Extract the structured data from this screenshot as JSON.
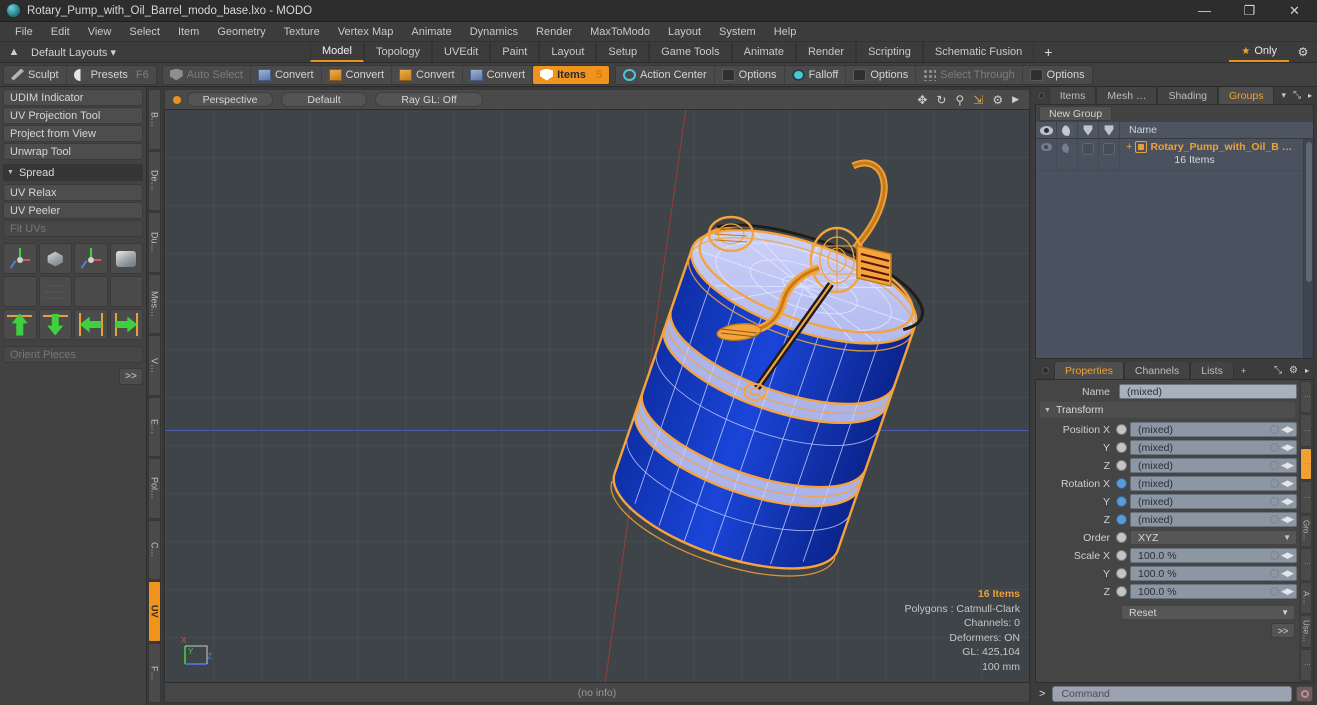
{
  "titlebar": {
    "title": "Rotary_Pump_with_Oil_Barrel_modo_base.lxo - MODO",
    "minimize": "—",
    "maximize": "❐",
    "close": "✕"
  },
  "menubar": {
    "items": [
      "File",
      "Edit",
      "View",
      "Select",
      "Item",
      "Geometry",
      "Texture",
      "Vertex Map",
      "Animate",
      "Dynamics",
      "Render",
      "MaxToModo",
      "Layout",
      "System",
      "Help"
    ]
  },
  "layoutbar": {
    "default_layouts": "Default Layouts ▾",
    "tabs": [
      "Model",
      "Topology",
      "UVEdit",
      "Paint",
      "Layout",
      "Setup",
      "Game Tools",
      "Animate",
      "Render",
      "Scripting",
      "Schematic Fusion"
    ],
    "active_tab": "Model",
    "plus": "+",
    "only_label": "Only",
    "gear": "⚙"
  },
  "modebar": {
    "group1": [
      {
        "label": "Sculpt",
        "icon": "sculpt-icon",
        "state": "normal"
      },
      {
        "label": "Presets",
        "icon": "presets-icon",
        "state": "normal",
        "shortcut": "F6"
      }
    ],
    "group2": [
      {
        "label": "Auto Select",
        "icon": "shield-icon",
        "state": "dim"
      },
      {
        "label": "Convert",
        "icon": "vertex-icon",
        "state": "normal"
      },
      {
        "label": "Convert",
        "icon": "edge-icon",
        "state": "normal"
      },
      {
        "label": "Convert",
        "icon": "polygon-icon",
        "state": "normal"
      },
      {
        "label": "Convert",
        "icon": "material-icon",
        "state": "normal"
      },
      {
        "label": "Items",
        "icon": "items-icon",
        "state": "selected",
        "count": "5"
      }
    ],
    "group3": [
      {
        "label": "Action Center",
        "icon": "action-center-icon",
        "state": "normal"
      },
      {
        "label": "Options",
        "icon": "options-box-icon",
        "state": "normal"
      },
      {
        "label": "Falloff",
        "icon": "falloff-icon",
        "state": "normal"
      },
      {
        "label": "Options",
        "icon": "options-box-icon",
        "state": "normal"
      },
      {
        "label": "Select Through",
        "icon": "select-through-icon",
        "state": "dim"
      },
      {
        "label": "Options",
        "icon": "options-box-icon",
        "state": "normal"
      }
    ]
  },
  "left_panel": {
    "tools": [
      {
        "label": "UDIM Indicator",
        "state": "normal"
      },
      {
        "label": "UV Projection Tool",
        "state": "normal"
      },
      {
        "label": "Project from View",
        "state": "normal"
      },
      {
        "label": "Unwrap Tool",
        "state": "normal"
      }
    ],
    "section": {
      "label": "Spread",
      "collapse_icon": "triangle-down-icon"
    },
    "tools2": [
      {
        "label": "UV Relax",
        "state": "normal"
      },
      {
        "label": "UV Peeler",
        "state": "normal"
      },
      {
        "label": "Fit UVs",
        "state": "dim"
      }
    ],
    "icon_buttons": [
      "uv-transform-icon",
      "uv-rotate-icon",
      "uv-move-icon",
      "uv-flatten-icon",
      "uv-unwrap-icon",
      "uv-grid-icon",
      "uv-cone-icon",
      "uv-distort-icon",
      "align-up-icon",
      "align-down-icon",
      "align-left-icon",
      "align-right-icon"
    ],
    "orient_pieces": {
      "label": "Orient Pieces",
      "state": "dim"
    },
    "more_button": ">>",
    "vtabs": [
      "B…",
      "De…",
      "Du…",
      "Mes…",
      "V…",
      "E…",
      "Pol…",
      "C…",
      "UV",
      "F…"
    ],
    "vtabs_active": "UV"
  },
  "viewport": {
    "header": {
      "view_mode": "Perspective",
      "shading": "Default",
      "ray_gl": "Ray GL: Off",
      "tools": [
        "move-icon",
        "rotate-icon",
        "zoom-icon",
        "fit-icon",
        "gear-icon",
        "play-icon"
      ]
    },
    "info": {
      "items": "16 Items",
      "polygons": "Polygons : Catmull-Clark",
      "channels": "Channels: 0",
      "deformers": "Deformers: ON",
      "gl": "GL: 425,104",
      "scale": "100 mm"
    },
    "axis_labels": {
      "x": "X",
      "y": "Y",
      "z": "Z"
    },
    "status": "(no info)",
    "colors": {
      "background": "#3e4448",
      "wireframe_selected": "#f5a33c",
      "surface_top": "#b9c0f0",
      "surface_body": "#1539b8",
      "axis_z": "#4f62c0",
      "axis_x": "#9c3b3b"
    }
  },
  "right_panel": {
    "top_tabs": {
      "items": [
        "Items",
        "Mesh …",
        "Shading",
        "Groups"
      ],
      "active": "Groups",
      "caret": "▾",
      "expand": "⤡",
      "arrow": "▸"
    },
    "groups": {
      "new_group_label": "New Group",
      "columns": [
        "eye-icon",
        "shade-icon",
        "lock-icon",
        "render-icon",
        "Name"
      ],
      "rows": [
        {
          "name": "Rotary_Pump_with_Oil_B …",
          "count": "16 Items",
          "expand": "+"
        }
      ]
    },
    "props_tabs": {
      "items": [
        "Properties",
        "Channels",
        "Lists"
      ],
      "active": "Properties",
      "plus": "+",
      "expand": "⤡",
      "gear": "⚙",
      "arrow": "▸"
    },
    "properties": {
      "name_label": "Name",
      "name_value": "(mixed)",
      "transform_section": "Transform",
      "fields": [
        {
          "label": "Position X",
          "value": "(mixed)",
          "radio": "grey"
        },
        {
          "label": "Y",
          "value": "(mixed)",
          "radio": "grey"
        },
        {
          "label": "Z",
          "value": "(mixed)",
          "radio": "grey"
        },
        {
          "label": "Rotation X",
          "value": "(mixed)",
          "radio": "blue"
        },
        {
          "label": "Y",
          "value": "(mixed)",
          "radio": "blue"
        },
        {
          "label": "Z",
          "value": "(mixed)",
          "radio": "blue"
        }
      ],
      "order": {
        "label": "Order",
        "value": "XYZ"
      },
      "scale": [
        {
          "label": "Scale X",
          "value": "100.0 %"
        },
        {
          "label": "Y",
          "value": "100.0 %"
        },
        {
          "label": "Z",
          "value": "100.0 %"
        }
      ],
      "reset": "Reset",
      "more_button": ">>"
    },
    "vtabs": [
      "⋮",
      "⋮",
      "⋮",
      "⋮",
      "Gro…",
      "⋮",
      "A…",
      "Use…",
      "⋮"
    ],
    "vtabs_active_index": 2,
    "command": {
      "prompt": ">",
      "placeholder": "Command",
      "record_icon": "record-icon"
    }
  }
}
